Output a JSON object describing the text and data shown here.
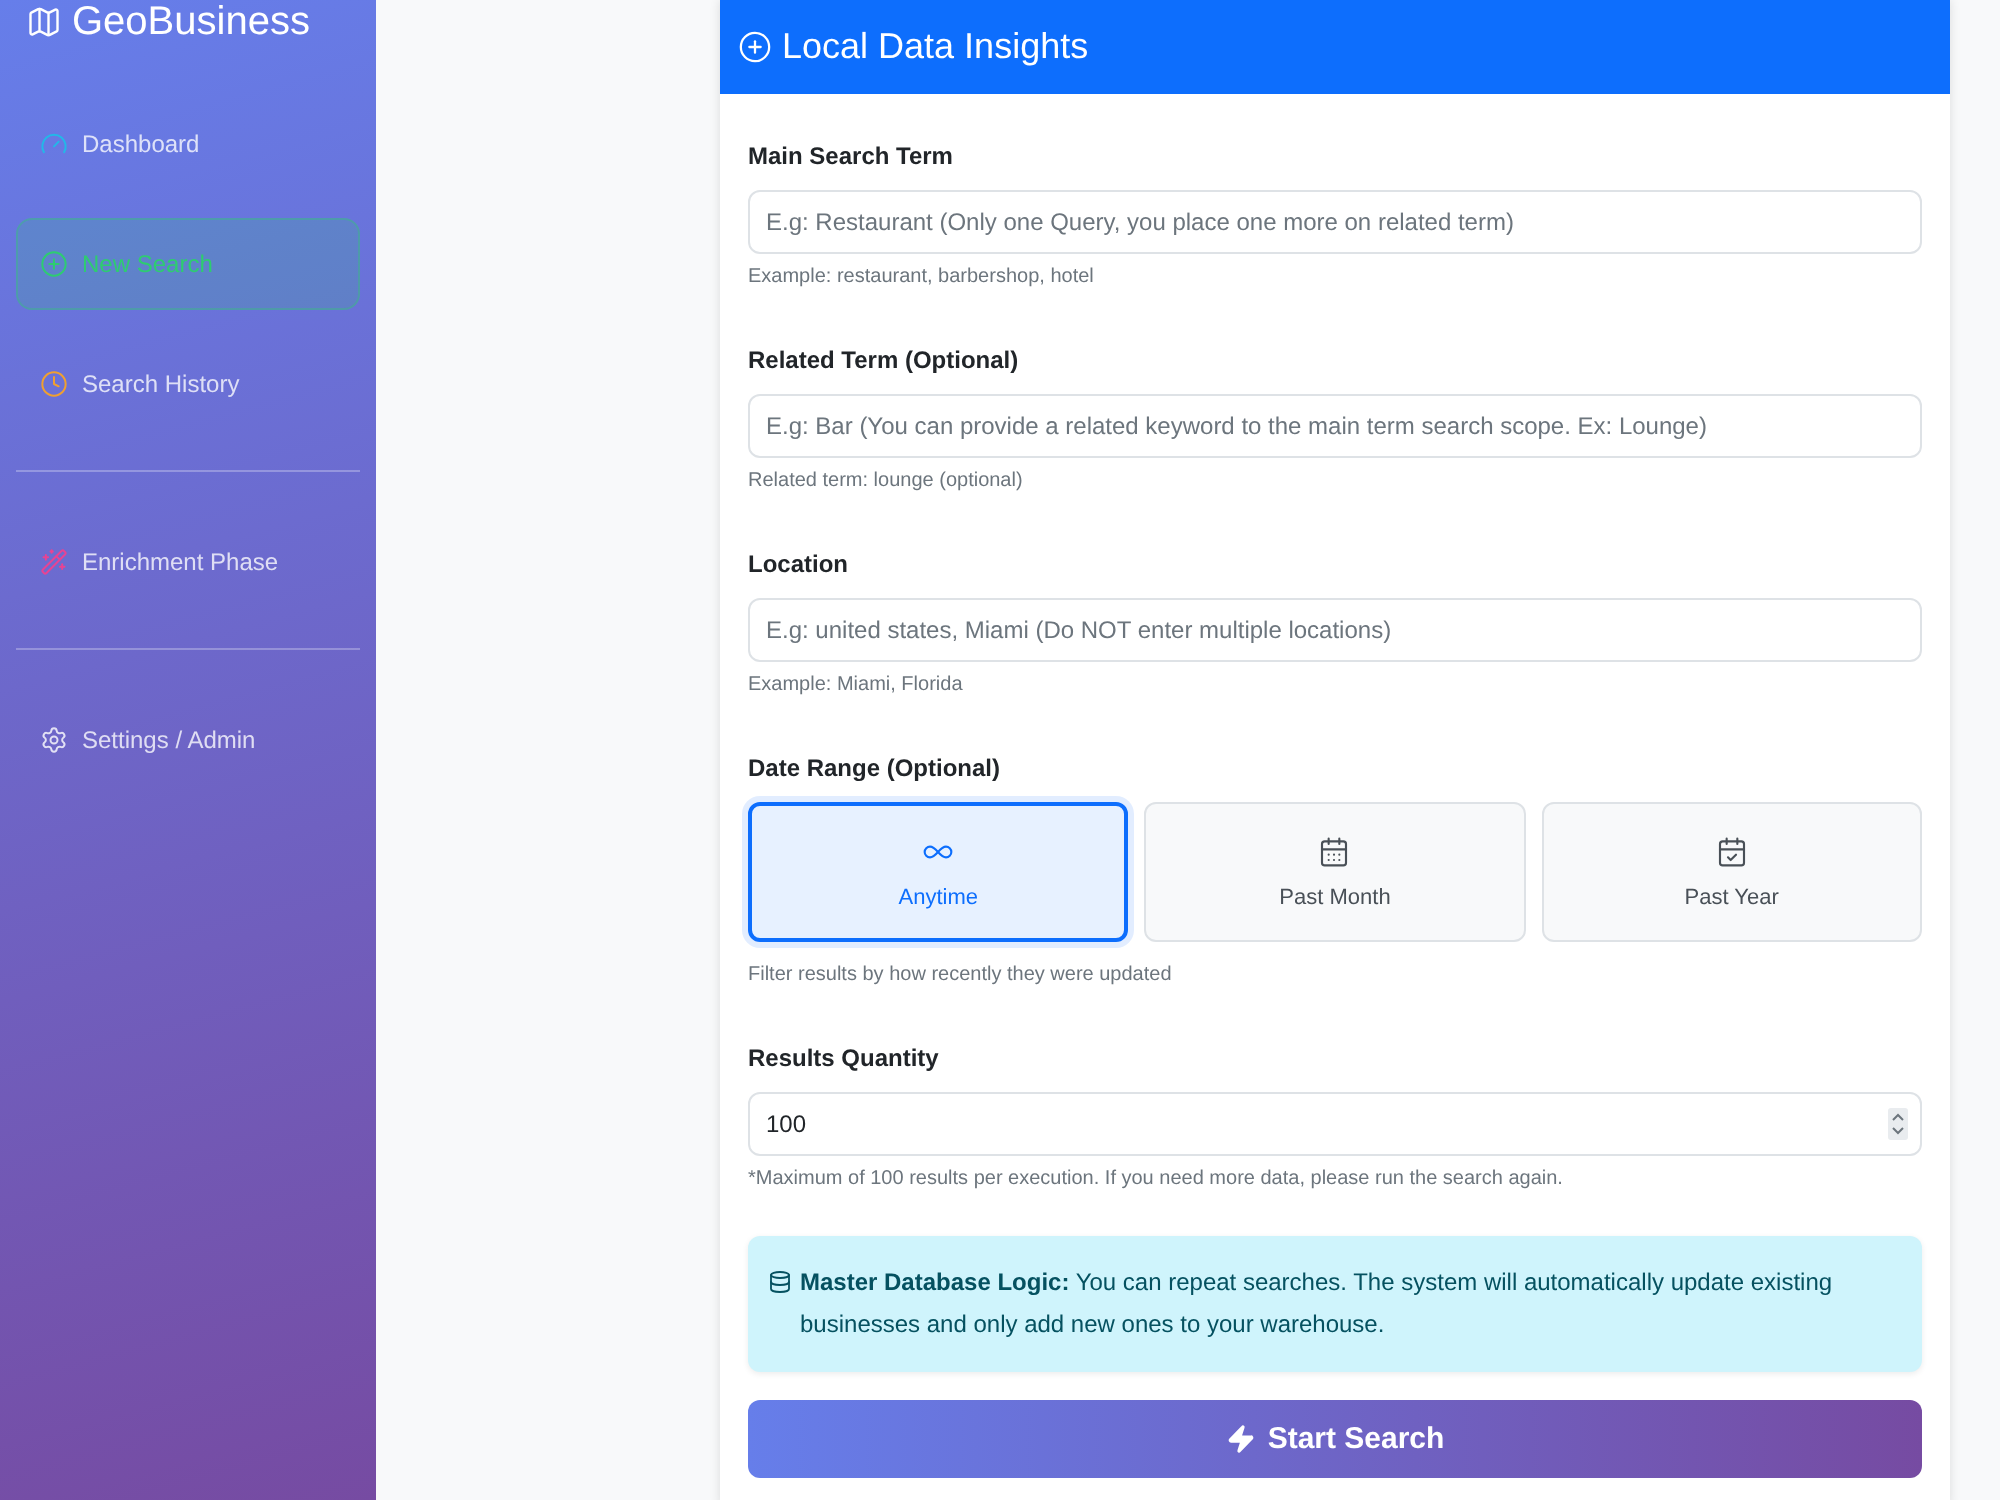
{
  "sidebar": {
    "brand": "GeoBusiness",
    "groups": [
      {
        "items": [
          {
            "label": "Dashboard",
            "selected": false
          },
          {
            "label": "New Search",
            "selected": true
          },
          {
            "label": "Search History",
            "selected": false
          }
        ]
      },
      {
        "items": [
          {
            "label": "Enrichment Phase",
            "selected": false
          }
        ]
      },
      {
        "items": [
          {
            "label": "Settings / Admin",
            "selected": false
          }
        ]
      }
    ]
  },
  "form": {
    "title": "Local Data Insights",
    "fields": [
      {
        "kind": "text",
        "label": "Main Search Term",
        "placeholder": "E.g: Restaurant (Only one Query, you place one more on related term)",
        "help": "Example: restaurant, barbershop, hotel"
      },
      {
        "kind": "text",
        "label": "Related Term (Optional)",
        "placeholder": "E.g: Bar (You can provide a related keyword to the main term search scope. Ex: Lounge)",
        "help": "Related term: lounge (optional)"
      },
      {
        "kind": "text",
        "label": "Location",
        "placeholder": "E.g: united states, Miami (Do NOT enter multiple locations)",
        "help": "Example: Miami, Florida"
      },
      {
        "kind": "options",
        "label": "Date Range (Optional)",
        "options": [
          {
            "label": "Anytime",
            "selected": true
          },
          {
            "label": "Past Month",
            "selected": false
          },
          {
            "label": "Past Year",
            "selected": false
          }
        ],
        "help": "Filter results by how recently they were updated"
      },
      {
        "kind": "number",
        "label": "Results Quantity",
        "value": "100",
        "help": "*Maximum of 100 results per execution. If you need more data, please run the search again."
      }
    ],
    "notice": "**Master Database Logic:** You can repeat searches. The system will automatically update existing businesses and only add new ones to your warehouse.",
    "submit": "Start Search"
  }
}
